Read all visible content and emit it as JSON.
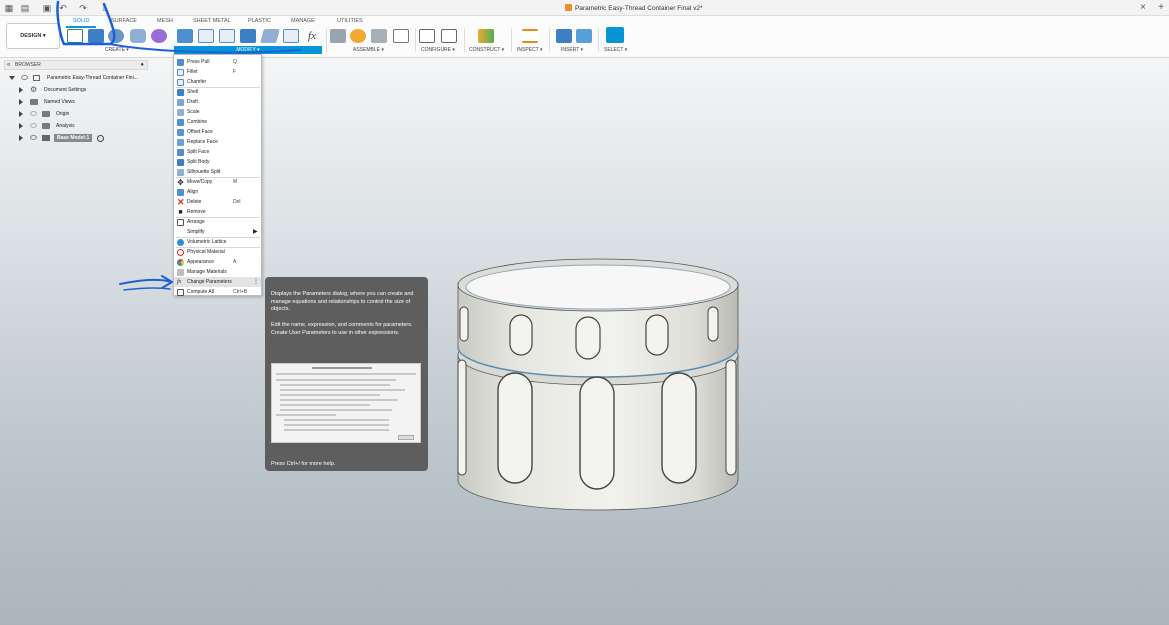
{
  "window": {
    "title": "Parametric Easy-Thread Container Final v2*",
    "close_glyph": "×",
    "plus_glyph": "+"
  },
  "ribbon": {
    "workspace_button": "DESIGN",
    "tabs": [
      "SOLID",
      "SURFACE",
      "MESH",
      "SHEET METAL",
      "PLASTIC",
      "MANAGE",
      "UTILITIES"
    ],
    "active_tab": "SOLID",
    "groups": {
      "create": "CREATE",
      "modify": "MODIFY",
      "assemble": "ASSEMBLE",
      "configure": "CONFIGURE",
      "construct": "CONSTRUCT",
      "inspect": "INSPECT",
      "insert": "INSERT",
      "select": "SELECT"
    },
    "fx_glyph": "fx",
    "accent_color": "#0696d7"
  },
  "browser": {
    "header": "BROWSER",
    "root": "Parametric Easy-Thread Container Fini...",
    "items": [
      {
        "label": "Document Settings"
      },
      {
        "label": "Named Views"
      },
      {
        "label": "Origin"
      },
      {
        "label": "Analysis"
      },
      {
        "label": "Base Model:1"
      }
    ]
  },
  "modify_menu": {
    "items": [
      {
        "label": "Press Pull",
        "shortcut": "Q"
      },
      {
        "label": "Fillet",
        "shortcut": "F"
      },
      {
        "label": "Chamfer",
        "shortcut": ""
      },
      {
        "label": "Shell",
        "shortcut": ""
      },
      {
        "label": "Draft",
        "shortcut": ""
      },
      {
        "label": "Scale",
        "shortcut": ""
      },
      {
        "label": "Combine",
        "shortcut": ""
      },
      {
        "label": "Offset Face",
        "shortcut": ""
      },
      {
        "label": "Replace Face",
        "shortcut": ""
      },
      {
        "label": "Split Face",
        "shortcut": ""
      },
      {
        "label": "Split Body",
        "shortcut": ""
      },
      {
        "label": "Silhouette Split",
        "shortcut": ""
      },
      {
        "label": "Move/Copy",
        "shortcut": "M"
      },
      {
        "label": "Align",
        "shortcut": ""
      },
      {
        "label": "Delete",
        "shortcut": "Del"
      },
      {
        "label": "Remove",
        "shortcut": ""
      },
      {
        "label": "Arrange",
        "shortcut": ""
      },
      {
        "label": "Simplify",
        "shortcut": ""
      },
      {
        "label": "Volumetric Lattice",
        "shortcut": ""
      },
      {
        "label": "Physical Material",
        "shortcut": ""
      },
      {
        "label": "Appearance",
        "shortcut": "A"
      },
      {
        "label": "Manage Materials",
        "shortcut": ""
      },
      {
        "label": "Change Parameters",
        "shortcut": ""
      },
      {
        "label": "Compute All",
        "shortcut": "Ctrl+B"
      }
    ],
    "highlighted": "Change Parameters"
  },
  "tooltip": {
    "paragraph1": "Displays the Parameters dialog, where you can create and manage equations and relationships to control the size of objects.",
    "paragraph2": "Edit the name, expression, and comments for parameters. Create User Parameters to use in other expressions.",
    "footer": "Press Ctrl+/ for more help."
  },
  "annotation_color": "#1f5fd6"
}
